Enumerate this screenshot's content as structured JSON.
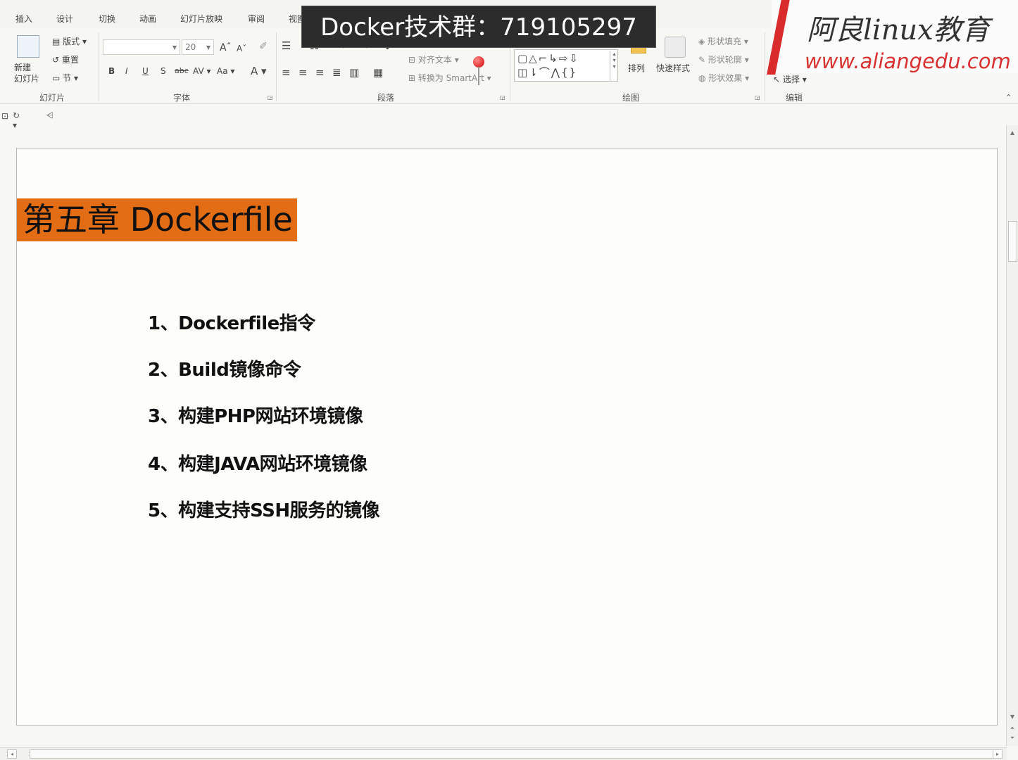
{
  "ribbon": {
    "tabs": [
      "插入",
      "设计",
      "切换",
      "动画",
      "幻灯片放映",
      "审阅",
      "视图"
    ],
    "groups": {
      "slides": {
        "label": "幻灯片",
        "new_slide": "新建\n幻灯片",
        "layout": "版式",
        "reset": "重置",
        "section": "节"
      },
      "font": {
        "label": "字体",
        "size_value": "20",
        "bold": "B",
        "italic": "I",
        "underline": "U",
        "shadow": "S",
        "strike": "abc",
        "spacing": "AV",
        "case": "Aa",
        "color": "A",
        "grow": "A",
        "shrink": "A"
      },
      "paragraph": {
        "label": "段落",
        "align_text": "对齐文本",
        "convert_smartart": "转换为 SmartArt"
      },
      "drawing": {
        "label": "绘图",
        "shapes_row1": "▢△⌐↳⇨⇩",
        "shapes_row2": "◫⇂⌒⋀{}",
        "arrange": "排列",
        "quick_styles": "快速样式",
        "shape_fill": "形状填充",
        "shape_outline": "形状轮廓",
        "shape_effects": "形状效果"
      },
      "editing": {
        "label": "编辑",
        "select": "选择"
      }
    }
  },
  "overlay": {
    "banner": "Docker技术群：719105297",
    "logo_title": "阿良linux教育",
    "logo_url": "www.aliangedu.com"
  },
  "slide": {
    "title": "第五章 Dockerfile",
    "items": [
      "1、Dockerfile指令",
      "2、Build镜像命令",
      "3、构建PHP网站环境镜像",
      "4、构建JAVA网站环境镜像",
      "5、构建支持SSH服务的镜像"
    ]
  },
  "colors": {
    "title_fill": "#e26d14",
    "logo_red": "#d92b2b"
  }
}
